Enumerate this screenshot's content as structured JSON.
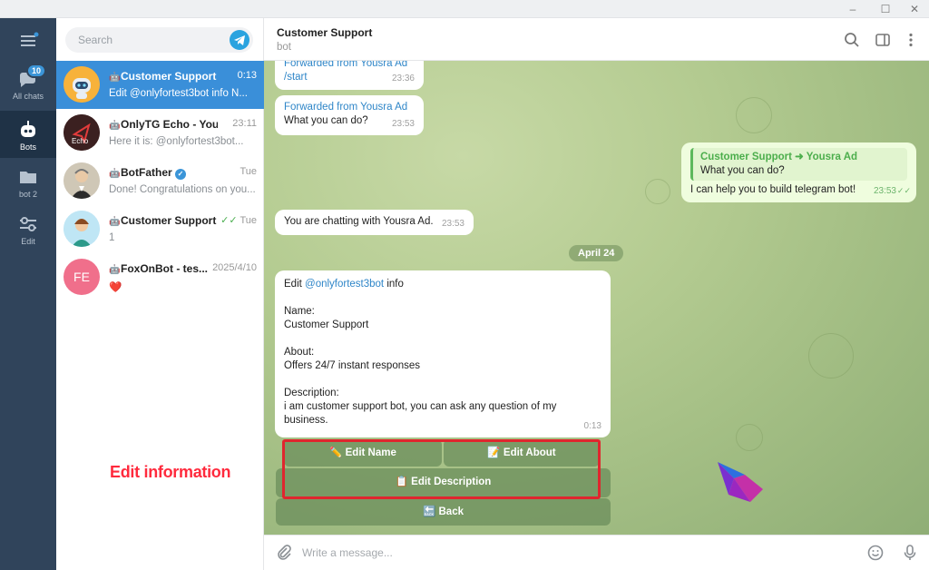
{
  "window": {
    "minimize_glyph": "–",
    "maximize_glyph": "☐",
    "close_glyph": "✕"
  },
  "rail": {
    "items": [
      {
        "label": "",
        "icon": "menu-icon"
      },
      {
        "label": "All chats",
        "icon": "chats-icon",
        "badge": "10"
      },
      {
        "label": "Bots",
        "icon": "bot-icon"
      },
      {
        "label": "bot 2",
        "icon": "folder-icon"
      },
      {
        "label": "Edit",
        "icon": "sliders-icon"
      }
    ]
  },
  "search": {
    "placeholder": "Search"
  },
  "chats": [
    {
      "name": "Customer Support",
      "time": "0:13",
      "preview": "Edit @onlyfortest3bot info  N..."
    },
    {
      "name": "OnlyTG Echo - Your ...",
      "time": "23:11",
      "preview": "Here it is: @onlyfortest3bot...",
      "avatar_text": "Echo"
    },
    {
      "name": "BotFather",
      "time": "Tue",
      "preview": "Done! Congratulations on you..."
    },
    {
      "name": "Customer Support",
      "time": "Tue",
      "preview": "1"
    },
    {
      "name": "FoxOnBot - tes...",
      "time": "2025/4/10",
      "preview": "❤️",
      "avatar_text": "FE"
    }
  ],
  "header": {
    "title": "Customer Support",
    "subtitle": "bot"
  },
  "messages": {
    "m1": {
      "forward": "Forwarded from Yousra Ad",
      "text": "/start",
      "time": "23:36"
    },
    "m2": {
      "forward": "Forwarded from Yousra Ad",
      "text": "What you can do?",
      "time": "23:53"
    },
    "m3": {
      "quote_from": "Customer Support",
      "quote_to": "Yousra Ad",
      "quote_text": "What you can do?",
      "text": "I can help you to build telegram bot!",
      "time": "23:53"
    },
    "m4": {
      "text": "You are chatting with Yousra Ad.",
      "time": "23:53"
    },
    "date": "April 24",
    "m5": {
      "line1_prefix": "Edit ",
      "line1_link": "@onlyfortest3bot",
      "line1_suffix": " info",
      "name_label": "Name:",
      "name_value": "Customer Support",
      "about_label": "About:",
      "about_value": "Offers 24/7 instant responses",
      "desc_label": "Description:",
      "desc_value": "i am customer support bot, you can ask any question of my business.",
      "time": "0:13"
    }
  },
  "keyboard": {
    "edit_name": "✏️ Edit Name",
    "edit_about": "📝 Edit About",
    "edit_description": "📋 Edit Description",
    "back": "🔙 Back"
  },
  "annotation": "Edit information",
  "composer": {
    "placeholder": "Write a message..."
  }
}
